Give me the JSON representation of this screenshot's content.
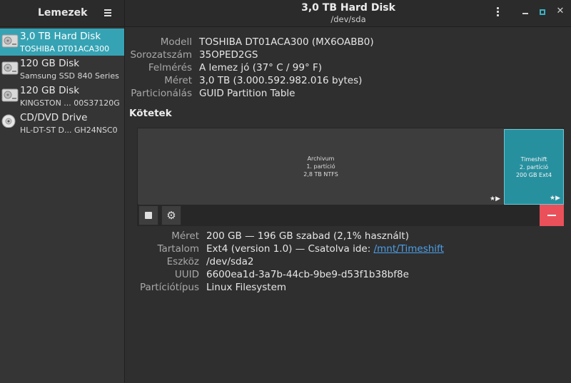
{
  "header": {
    "sidebar_title": "Lemezek",
    "title": "3,0 TB Hard Disk",
    "subtitle": "/dev/sda"
  },
  "sidebar": {
    "items": [
      {
        "name": "3,0 TB Hard Disk",
        "model": "TOSHIBA DT01ACA300",
        "icon": "hard-disk-icon",
        "selected": true
      },
      {
        "name": "120 GB Disk",
        "model": "Samsung SSD 840 Series",
        "icon": "hard-disk-icon",
        "selected": false
      },
      {
        "name": "120 GB Disk",
        "model": "KINGSTON ... 00S37120G",
        "icon": "hard-disk-icon",
        "selected": false
      },
      {
        "name": "CD/DVD Drive",
        "model": "HL-DT-ST D...   GH24NSC0",
        "icon": "optical-disc-icon",
        "selected": false
      }
    ]
  },
  "disk_props": [
    {
      "label": "Modell",
      "value": "TOSHIBA DT01ACA300 (MX6OABB0)"
    },
    {
      "label": "Sorozatszám",
      "value": "35OPED2GS"
    },
    {
      "label": "Felmérés",
      "value": "A lemez jó (37° C / 99° F)"
    },
    {
      "label": "Méret",
      "value": "3,0 TB (3.000.592.982.016 bytes)"
    },
    {
      "label": "Particionálás",
      "value": "GUID Partition Table"
    }
  ],
  "volumes_title": "Kötetek",
  "volumes": [
    {
      "name": "Archivum",
      "part": "1. partíció",
      "info": "2,8 TB NTFS",
      "selected": false
    },
    {
      "name": "Timeshift",
      "part": "2. partíció",
      "info": "200 GB Ext4",
      "selected": true
    }
  ],
  "volume_flags": "★▶",
  "detail_props": [
    {
      "label": "Méret",
      "value": "200 GB — 196 GB szabad (2,1% használt)"
    },
    {
      "label": "Tartalom",
      "value": "Ext4 (version 1.0) — Csatolva ide: ",
      "link": "/mnt/Timeshift"
    },
    {
      "label": "Eszköz",
      "value": "/dev/sda2"
    },
    {
      "label": "UUID",
      "value": "6600ea1d-3a7b-44cb-9be9-d53f1b38bf8e"
    },
    {
      "label": "Partíciótípus",
      "value": "Linux Filesystem"
    }
  ],
  "colors": {
    "accent": "#36a3b4",
    "destructive": "#e9505a",
    "link": "#4b9fe8"
  }
}
